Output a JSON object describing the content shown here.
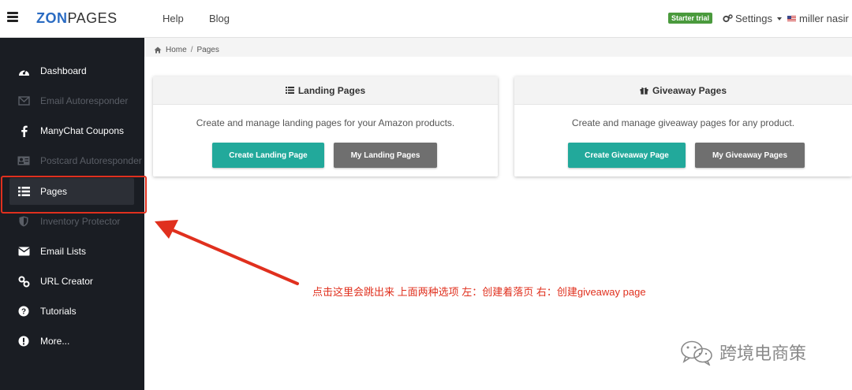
{
  "topbar": {
    "logo_a": "ZON",
    "logo_b": "PAGES",
    "nav": [
      "Help",
      "Blog"
    ],
    "badge": "Starter trial",
    "settings_label": "Settings",
    "user_label": "miller nasir"
  },
  "sidebar": {
    "items": [
      {
        "label": "Dashboard",
        "icon": "dashboard-icon"
      },
      {
        "label": "Email Autoresponder",
        "icon": "envelope-outline-icon"
      },
      {
        "label": "ManyChat Coupons",
        "icon": "facebook-icon"
      },
      {
        "label": "Postcard Autoresponder",
        "icon": "contact-card-icon"
      },
      {
        "label": "Pages",
        "icon": "list-icon"
      },
      {
        "label": "Inventory Protector",
        "icon": "shield-icon"
      },
      {
        "label": "Email Lists",
        "icon": "envelope-icon"
      },
      {
        "label": "URL Creator",
        "icon": "link-icon"
      },
      {
        "label": "Tutorials",
        "icon": "question-circle-icon"
      },
      {
        "label": "More...",
        "icon": "exclamation-circle-icon"
      }
    ],
    "active_index": 4
  },
  "breadcrumb": {
    "home": "Home",
    "separator": "/",
    "current": "Pages"
  },
  "cards": {
    "landing": {
      "title": "Landing Pages",
      "description": "Create and manage landing pages for your Amazon products.",
      "primary_button": "Create Landing Page",
      "secondary_button": "My Landing Pages"
    },
    "giveaway": {
      "title": "Giveaway Pages",
      "description": "Create and manage giveaway pages for any product.",
      "primary_button": "Create Giveaway Page",
      "secondary_button": "My Giveaway Pages"
    }
  },
  "annotation": {
    "note": "点击这里会跳出来 上面两种选项  左：创建着落页  右：创建giveaway page"
  },
  "watermark": {
    "text": "跨境电商策"
  },
  "colors": {
    "sidebar_bg": "#1a1d23",
    "accent_teal": "#22a99b",
    "button_grey": "#6f6f6f",
    "badge_green": "#4a9a3d",
    "annotation_red": "#e0301e",
    "logo_blue": "#2a6bc2"
  }
}
